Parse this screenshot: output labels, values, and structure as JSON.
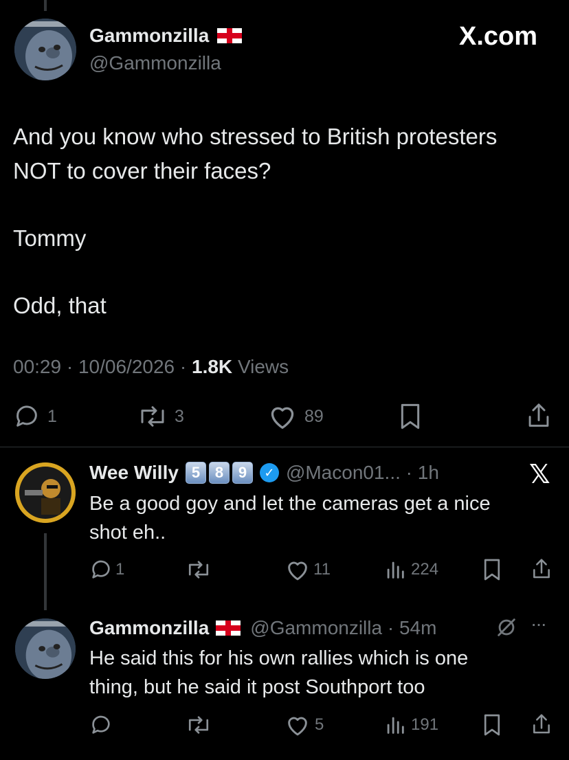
{
  "main_tweet": {
    "display_name": "Gammonzilla",
    "handle": "@Gammonzilla",
    "brand": "X.com",
    "text_line1": "And you know who stressed to British protesters",
    "text_line2": "NOT to cover their faces?",
    "text_line3": "Tommy",
    "text_line4": "Odd, that",
    "time": "00:29",
    "date": "10/06/2026",
    "views_count": "1.8K",
    "views_label": "Views",
    "replies": "1",
    "reposts": "3",
    "likes": "89"
  },
  "reply1": {
    "display_name": "Wee Willy",
    "badges": [
      "5",
      "8",
      "9"
    ],
    "handle_time": "@Macon01... · 1h",
    "text_line1": "Be a good goy and let the cameras get a nice",
    "text_line2": "shot eh..",
    "replies": "1",
    "reposts": "",
    "likes": "11",
    "views": "224"
  },
  "reply2": {
    "display_name": "Gammonzilla",
    "handle_time": "@Gammonzilla · 54m",
    "text_line1": "He said this for his own rallies which is one",
    "text_line2": "thing, but he said it post Southport too",
    "replies": "",
    "reposts": "",
    "likes": "5",
    "views": "191"
  },
  "colors": {
    "background": "#000000",
    "text": "#e7e9ea",
    "muted": "#71767b",
    "verified": "#1d9bf0",
    "flag_red": "#d6001c"
  },
  "icons": [
    "reply-icon",
    "repost-icon",
    "like-icon",
    "bookmark-icon",
    "share-icon",
    "views-icon",
    "verified-icon",
    "x-logo-icon",
    "more-icon",
    "grok-icon"
  ]
}
